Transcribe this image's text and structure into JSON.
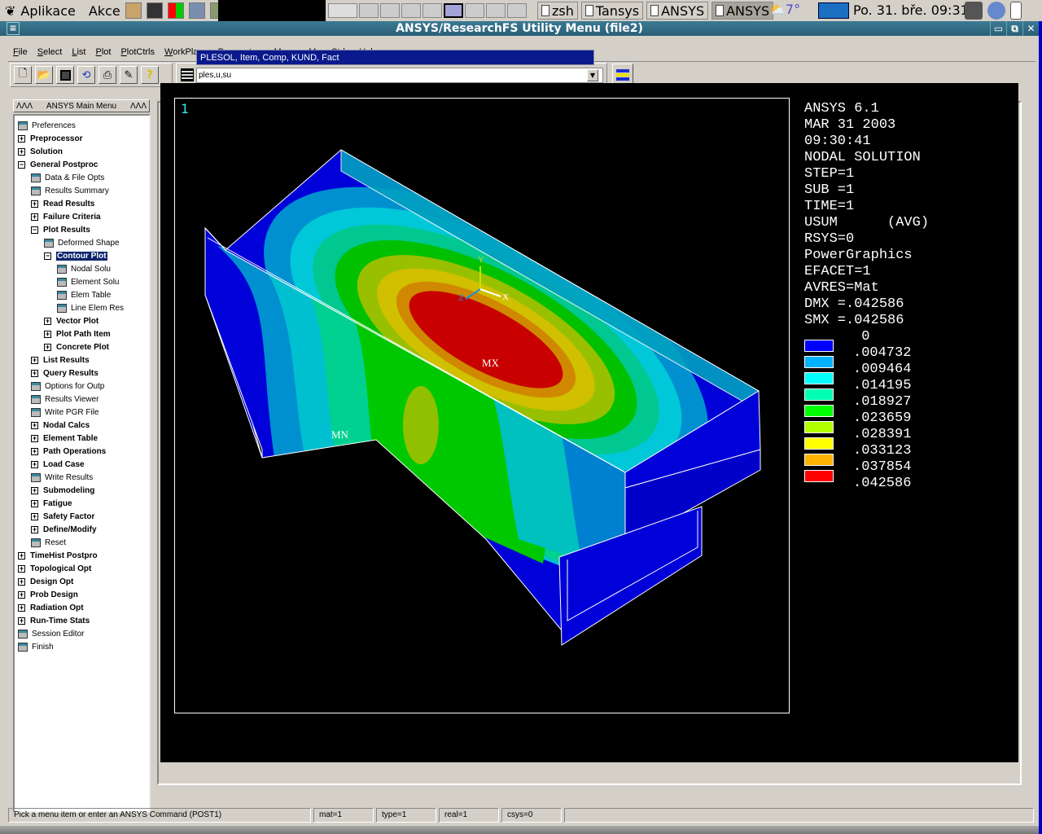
{
  "top_panel": {
    "apps_menu": "Aplikace",
    "actions_menu": "Akce",
    "tasks": [
      {
        "label": "zsh",
        "active": false
      },
      {
        "label": "Tansys",
        "active": false
      },
      {
        "label": "ANSYS",
        "active": false
      },
      {
        "label": "ANSYS",
        "active": true
      }
    ],
    "weather": "7°",
    "clock": "Po. 31. bře. 09:31"
  },
  "window": {
    "title": "ANSYS/ResearchFS Utility Menu (file2)"
  },
  "menubar": [
    "File",
    "Select",
    "List",
    "Plot",
    "PlotCtrls",
    "WorkPlane",
    "Parameters",
    "Macro",
    "MenuCtrls",
    "Help"
  ],
  "tooltip": "PLESOL, Item, Comp, KUND, Fact",
  "toolbar": {
    "buttons": [
      "new-file",
      "open-file",
      "save",
      "pan-zoom-rotate",
      "print",
      "report",
      "help"
    ]
  },
  "command": {
    "value": "ples,u,su"
  },
  "main_menu": {
    "header": "ANSYS Main Menu",
    "items": [
      {
        "label": "Preferences",
        "type": "leaf",
        "level": 0,
        "bold": false
      },
      {
        "label": "Preprocessor",
        "type": "plus",
        "level": 0,
        "bold": true
      },
      {
        "label": "Solution",
        "type": "plus",
        "level": 0,
        "bold": true
      },
      {
        "label": "General Postproc",
        "type": "minus",
        "level": 0,
        "bold": true
      },
      {
        "label": "Data & File Opts",
        "type": "leaf",
        "level": 1,
        "bold": false
      },
      {
        "label": "Results Summary",
        "type": "leaf",
        "level": 1,
        "bold": false
      },
      {
        "label": "Read Results",
        "type": "plus",
        "level": 1,
        "bold": true
      },
      {
        "label": "Failure Criteria",
        "type": "plus",
        "level": 1,
        "bold": true
      },
      {
        "label": "Plot Results",
        "type": "minus",
        "level": 1,
        "bold": true
      },
      {
        "label": "Deformed Shape",
        "type": "leaf",
        "level": 2,
        "bold": false
      },
      {
        "label": "Contour Plot",
        "type": "minus",
        "level": 2,
        "bold": true,
        "selected": true
      },
      {
        "label": "Nodal Solu",
        "type": "leaf",
        "level": 3,
        "bold": false
      },
      {
        "label": "Element Solu",
        "type": "leaf",
        "level": 3,
        "bold": false
      },
      {
        "label": "Elem Table",
        "type": "leaf",
        "level": 3,
        "bold": false
      },
      {
        "label": "Line Elem Res",
        "type": "leaf",
        "level": 3,
        "bold": false
      },
      {
        "label": "Vector Plot",
        "type": "plus",
        "level": 2,
        "bold": true
      },
      {
        "label": "Plot Path Item",
        "type": "plus",
        "level": 2,
        "bold": true
      },
      {
        "label": "Concrete Plot",
        "type": "plus",
        "level": 2,
        "bold": true
      },
      {
        "label": "List Results",
        "type": "plus",
        "level": 1,
        "bold": true
      },
      {
        "label": "Query Results",
        "type": "plus",
        "level": 1,
        "bold": true
      },
      {
        "label": "Options for Outp",
        "type": "leaf",
        "level": 1,
        "bold": false
      },
      {
        "label": "Results Viewer",
        "type": "leaf",
        "level": 1,
        "bold": false
      },
      {
        "label": "Write PGR File",
        "type": "leaf",
        "level": 1,
        "bold": false
      },
      {
        "label": "Nodal Calcs",
        "type": "plus",
        "level": 1,
        "bold": true
      },
      {
        "label": "Element Table",
        "type": "plus",
        "level": 1,
        "bold": true
      },
      {
        "label": "Path Operations",
        "type": "plus",
        "level": 1,
        "bold": true
      },
      {
        "label": "Load Case",
        "type": "plus",
        "level": 1,
        "bold": true
      },
      {
        "label": "Write Results",
        "type": "leaf",
        "level": 1,
        "bold": false
      },
      {
        "label": "Submodeling",
        "type": "plus",
        "level": 1,
        "bold": true
      },
      {
        "label": "Fatigue",
        "type": "plus",
        "level": 1,
        "bold": true
      },
      {
        "label": "Safety Factor",
        "type": "plus",
        "level": 1,
        "bold": true
      },
      {
        "label": "Define/Modify",
        "type": "plus",
        "level": 1,
        "bold": true
      },
      {
        "label": "Reset",
        "type": "leaf",
        "level": 1,
        "bold": false
      },
      {
        "label": "TimeHist Postpro",
        "type": "plus",
        "level": 0,
        "bold": true
      },
      {
        "label": "Topological Opt",
        "type": "plus",
        "level": 0,
        "bold": true
      },
      {
        "label": "Design Opt",
        "type": "plus",
        "level": 0,
        "bold": true
      },
      {
        "label": "Prob Design",
        "type": "plus",
        "level": 0,
        "bold": true
      },
      {
        "label": "Radiation Opt",
        "type": "plus",
        "level": 0,
        "bold": true
      },
      {
        "label": "Run-Time Stats",
        "type": "plus",
        "level": 0,
        "bold": true
      },
      {
        "label": "Session Editor",
        "type": "leaf",
        "level": 0,
        "bold": false
      },
      {
        "label": "Finish",
        "type": "leaf",
        "level": 0,
        "bold": false
      }
    ]
  },
  "graphics": {
    "window_number": "1",
    "info_lines": [
      "ANSYS 6.1",
      "MAR 31 2003",
      "09:30:41",
      "NODAL SOLUTION",
      "STEP=1",
      "SUB =1",
      "TIME=1",
      "USUM      (AVG)",
      "RSYS=0",
      "PowerGraphics",
      "EFACET=1",
      "AVRES=Mat",
      "DMX =.042586",
      "SMX =.042586"
    ],
    "max_label": "MX",
    "min_label": "MN",
    "axis_labels": {
      "x": "X",
      "y": "Y",
      "z": "Z"
    },
    "legend": {
      "levels": [
        "0",
        ".004732",
        ".009464",
        ".014195",
        ".018927",
        ".023659",
        ".028391",
        ".033123",
        ".037854",
        ".042586"
      ],
      "colors": [
        "#0000ff",
        "#00b2ff",
        "#00ffff",
        "#00ffb2",
        "#00ff00",
        "#b2ff00",
        "#ffff00",
        "#ffb200",
        "#ff0000"
      ]
    }
  },
  "status_bar": {
    "prompt": "Pick a menu item or enter an ANSYS Command (POST1)",
    "mat": "mat=1",
    "type": "type=1",
    "real": "real=1",
    "csys": "csys=0"
  }
}
